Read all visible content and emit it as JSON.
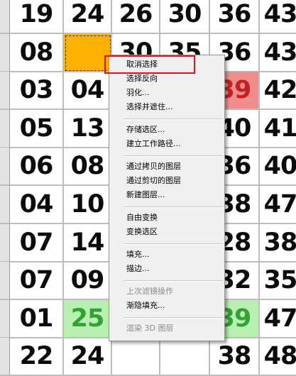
{
  "spreadsheet": {
    "rows": [
      [
        "19",
        "24",
        "26",
        "30",
        "36",
        "43"
      ],
      [
        "08",
        "",
        "30",
        "35",
        "36",
        "43"
      ],
      [
        "03",
        "04",
        "",
        "",
        "39",
        "42"
      ],
      [
        "05",
        "13",
        "",
        "",
        "40",
        "41"
      ],
      [
        "06",
        "08",
        "",
        "",
        "36",
        "40"
      ],
      [
        "04",
        "10",
        "",
        "",
        "38",
        "47"
      ],
      [
        "07",
        "14",
        "",
        "",
        "28",
        "38"
      ],
      [
        "07",
        "09",
        "",
        "",
        "32",
        "35"
      ],
      [
        "01",
        "25",
        "",
        "",
        "39",
        "47"
      ],
      [
        "22",
        "24",
        "",
        "",
        "38",
        "48"
      ]
    ],
    "colors": {
      "selected": "#ffb100",
      "green_highlight": "#b7f0b0",
      "red_highlight": "#f08e8e"
    }
  },
  "context_menu": {
    "items": [
      {
        "label": "取消选择",
        "enabled": true,
        "highlighted": true
      },
      {
        "label": "选择反向",
        "enabled": true
      },
      {
        "label": "羽化...",
        "enabled": true
      },
      {
        "label": "选择并遮住...",
        "enabled": true
      },
      {
        "label": "存储选区...",
        "enabled": true
      },
      {
        "label": "建立工作路径...",
        "enabled": true
      },
      {
        "label": "通过拷贝的图层",
        "enabled": true
      },
      {
        "label": "通过剪切的图层",
        "enabled": true
      },
      {
        "label": "新建图层...",
        "enabled": true
      },
      {
        "label": "自由变换",
        "enabled": true
      },
      {
        "label": "变换选区",
        "enabled": true
      },
      {
        "label": "填充...",
        "enabled": true
      },
      {
        "label": "描边...",
        "enabled": true
      },
      {
        "label": "上次滤镜操作",
        "enabled": false
      },
      {
        "label": "渐隐填充...",
        "enabled": true
      },
      {
        "label": "渲染 3D 图层",
        "enabled": false
      }
    ],
    "highlight_color": "#e0101f"
  }
}
